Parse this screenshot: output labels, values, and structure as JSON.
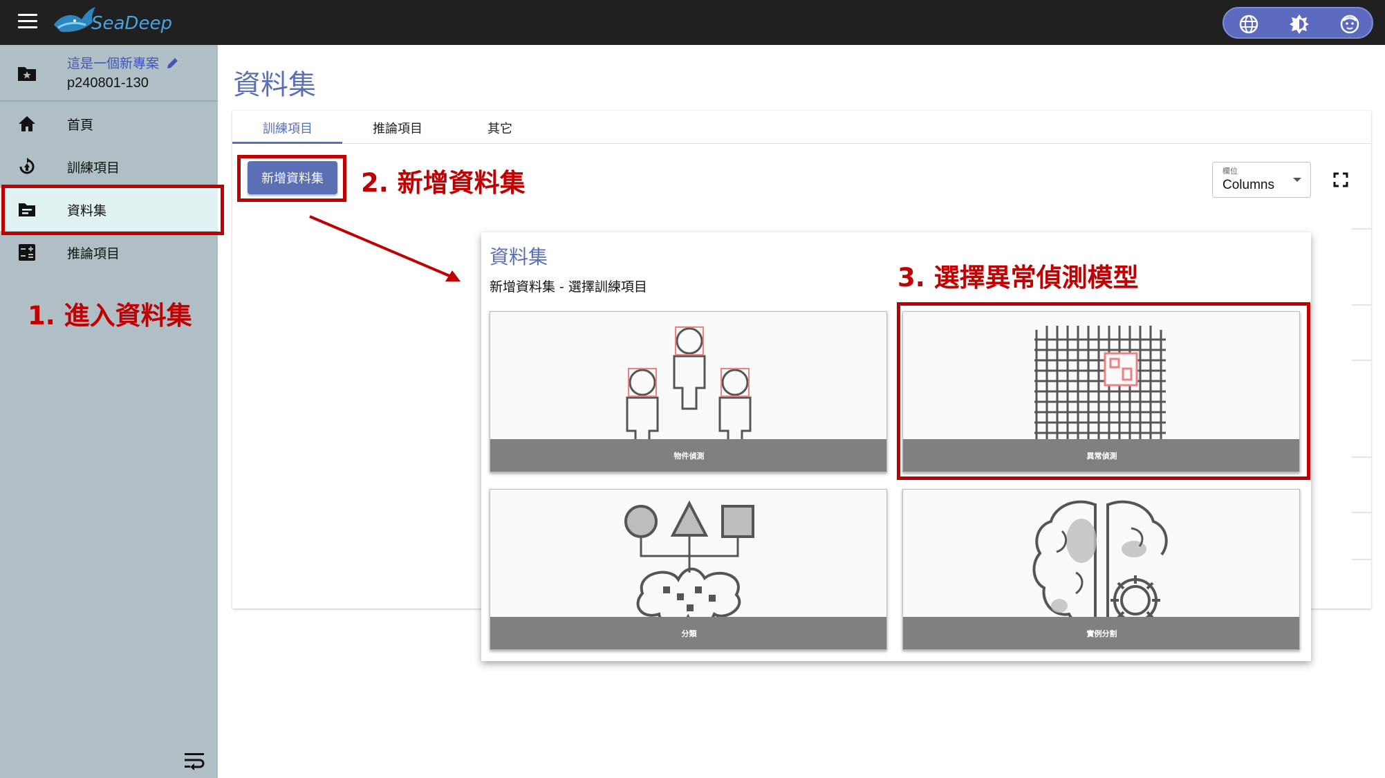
{
  "topbar": {
    "logo_text": "SeaDeep",
    "actions": [
      "globe-icon",
      "brightness-icon",
      "account-icon"
    ]
  },
  "sidebar": {
    "project_name": "這是一個新專案",
    "project_id": "p240801-130",
    "items": [
      {
        "label": "首頁",
        "icon": "home-icon"
      },
      {
        "label": "訓練項目",
        "icon": "training-icon"
      },
      {
        "label": "資料集",
        "icon": "dataset-folder-icon",
        "active": true
      },
      {
        "label": "推論項目",
        "icon": "calculator-icon"
      }
    ]
  },
  "page": {
    "title": "資料集",
    "tabs": [
      "訓練項目",
      "推論項目",
      "其它"
    ],
    "add_button": "新增資料集",
    "columns_select": {
      "label": "欄位",
      "value": "Columns"
    }
  },
  "dialog": {
    "title": "資料集",
    "subtitle": "新增資料集 - 選擇訓練項目",
    "cards": [
      "物件偵測",
      "異常偵測",
      "分類",
      "實例分割"
    ]
  },
  "annotations": {
    "step1": "1. 進入資料集",
    "step2": "2. 新增資料集",
    "step3": "3. 選擇異常偵測模型",
    "color": "#c00000"
  },
  "colors": {
    "accent": "#5b6fb5",
    "sidebar": "#b0bfc6",
    "topbar": "#202020"
  }
}
